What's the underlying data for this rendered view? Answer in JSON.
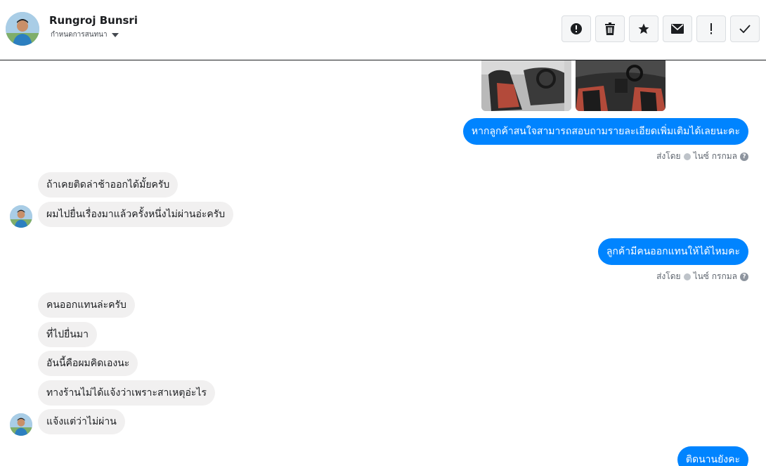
{
  "contact": {
    "name": "Rungroj Bunsri",
    "subtitle": "กำหนดการสนทนา"
  },
  "toolbar": [
    {
      "icon": "alert-circle-icon",
      "name": "mark-spam-button"
    },
    {
      "icon": "trash-icon",
      "name": "delete-button"
    },
    {
      "icon": "star-icon",
      "name": "star-button"
    },
    {
      "icon": "envelope-icon",
      "name": "mark-unread-button"
    },
    {
      "icon": "exclamation-icon",
      "name": "priority-button"
    },
    {
      "icon": "check-icon",
      "name": "done-button"
    }
  ],
  "messages": {
    "out1": "หากลูกค้าสนใจสามารถสอบถามรายละเอียดเพิ่มเติมได้เลยนะคะ",
    "sentby1_prefix": "ส่งโดย",
    "sentby1_name": "ไนซ์ กรกมล",
    "in1": "ถ้าเคยติดล่าช้าออกได้มั้ยครับ",
    "in2": "ผมไปยื่นเรื่องมาแล้วครั้งหนึ่งไม่ผ่านอ่ะครับ",
    "out2": "ลูกค้ามีคนออกแทนให้ได้ไหมคะ",
    "sentby2_prefix": "ส่งโดย",
    "sentby2_name": "ไนซ์ กรกมล",
    "in3": "คนออกแทนล่ะครับ",
    "in4": "ที่ไปยื่นมา",
    "in5": "อันนี้คือผมคิดเองนะ",
    "in6": "ทางร้านไม่ได้แจ้งว่าเพราะสาเหตุอ่ะไร",
    "in7": "แจ้งแต่ว่าไม่ผ่าน",
    "out3": "ติดนานยังคะ"
  },
  "colors": {
    "outgoing_bubble": "#0084ff",
    "incoming_bubble": "#f1f0f0"
  }
}
